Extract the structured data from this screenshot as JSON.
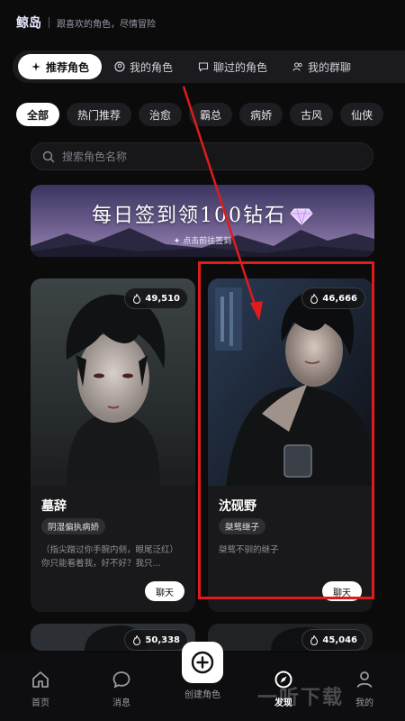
{
  "header": {
    "brand": "鲸岛",
    "tagline": "跟喜欢的角色，尽情冒险"
  },
  "tabs": [
    {
      "label": "推荐角色",
      "icon": "sparkle-icon",
      "active": true
    },
    {
      "label": "我的角色",
      "icon": "user-circle-icon",
      "active": false
    },
    {
      "label": "聊过的角色",
      "icon": "chat-bubble-icon",
      "active": false
    },
    {
      "label": "我的群聊",
      "icon": "group-icon",
      "active": false
    }
  ],
  "categories": [
    "全部",
    "热门推荐",
    "治愈",
    "霸总",
    "病娇",
    "古风",
    "仙侠"
  ],
  "search": {
    "placeholder": "搜索角色名称"
  },
  "banner": {
    "title": "每日签到领100钻石",
    "subtitle": "✦ 点击前往签到"
  },
  "cards": [
    {
      "likes": "49,510",
      "name": "墓辞",
      "tag": "阴湿偏执病娇",
      "desc": "（指尖蹭过你手腕内侧，眼尾泛红）你只能看着我，好不好？我只...",
      "button": "聊天"
    },
    {
      "likes": "46,666",
      "name": "沈砚野",
      "tag": "桀骜继子",
      "desc": "桀骜不驯的继子",
      "button": "聊天"
    },
    {
      "likes": "50,338"
    },
    {
      "likes": "45,046"
    }
  ],
  "nav": [
    {
      "label": "首页",
      "icon": "home-icon"
    },
    {
      "label": "消息",
      "icon": "message-icon"
    },
    {
      "label": "创建角色",
      "icon": "plus-icon"
    },
    {
      "label": "发现",
      "icon": "compass-icon",
      "active": true
    },
    {
      "label": "我的",
      "icon": "profile-icon"
    }
  ],
  "watermark": "一听下载",
  "colors": {
    "highlight": "#e01b1b",
    "accent": "#ffffff",
    "background": "#0b0b0c"
  }
}
